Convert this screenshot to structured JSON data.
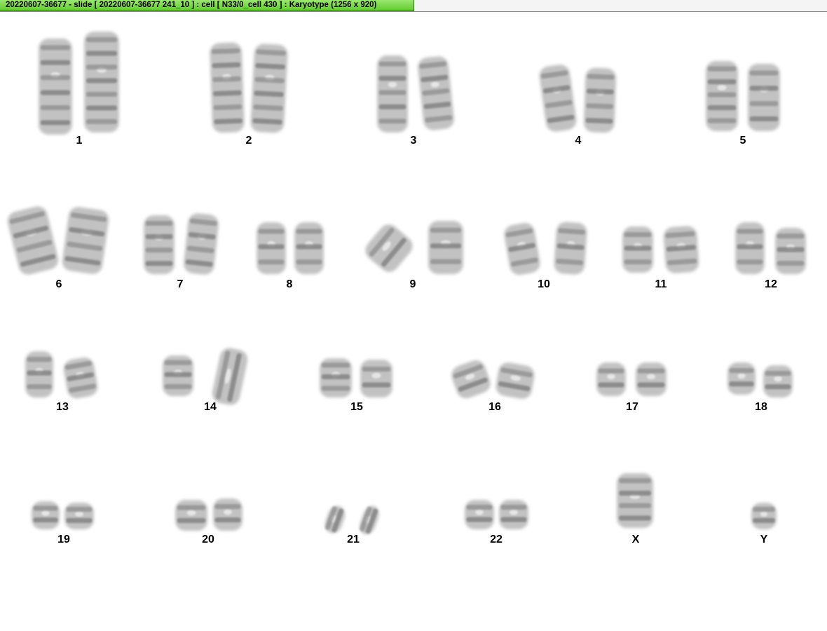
{
  "title_bar": {
    "text": "20220607-36677 - slide [ 20220607-36677 241_10 ] : cell [ N33/0_cell 430 ] : Karyotype  (1256 x 920)",
    "color": "#6fd83c"
  },
  "karyotype": {
    "chromosome_shade": "#7a7a7a",
    "label_color": "#000000",
    "pairs": [
      {
        "label": "1",
        "count": 2
      },
      {
        "label": "2",
        "count": 2
      },
      {
        "label": "3",
        "count": 2
      },
      {
        "label": "4",
        "count": 2
      },
      {
        "label": "5",
        "count": 2
      },
      {
        "label": "6",
        "count": 2
      },
      {
        "label": "7",
        "count": 2
      },
      {
        "label": "8",
        "count": 2
      },
      {
        "label": "9",
        "count": 2
      },
      {
        "label": "10",
        "count": 2
      },
      {
        "label": "11",
        "count": 2
      },
      {
        "label": "12",
        "count": 2
      },
      {
        "label": "13",
        "count": 2
      },
      {
        "label": "14",
        "count": 2
      },
      {
        "label": "15",
        "count": 2
      },
      {
        "label": "16",
        "count": 2
      },
      {
        "label": "17",
        "count": 2
      },
      {
        "label": "18",
        "count": 2
      },
      {
        "label": "19",
        "count": 2
      },
      {
        "label": "20",
        "count": 2
      },
      {
        "label": "21",
        "count": 2
      },
      {
        "label": "22",
        "count": 2
      },
      {
        "label": "X",
        "count": 1
      },
      {
        "label": "Y",
        "count": 1
      }
    ]
  }
}
